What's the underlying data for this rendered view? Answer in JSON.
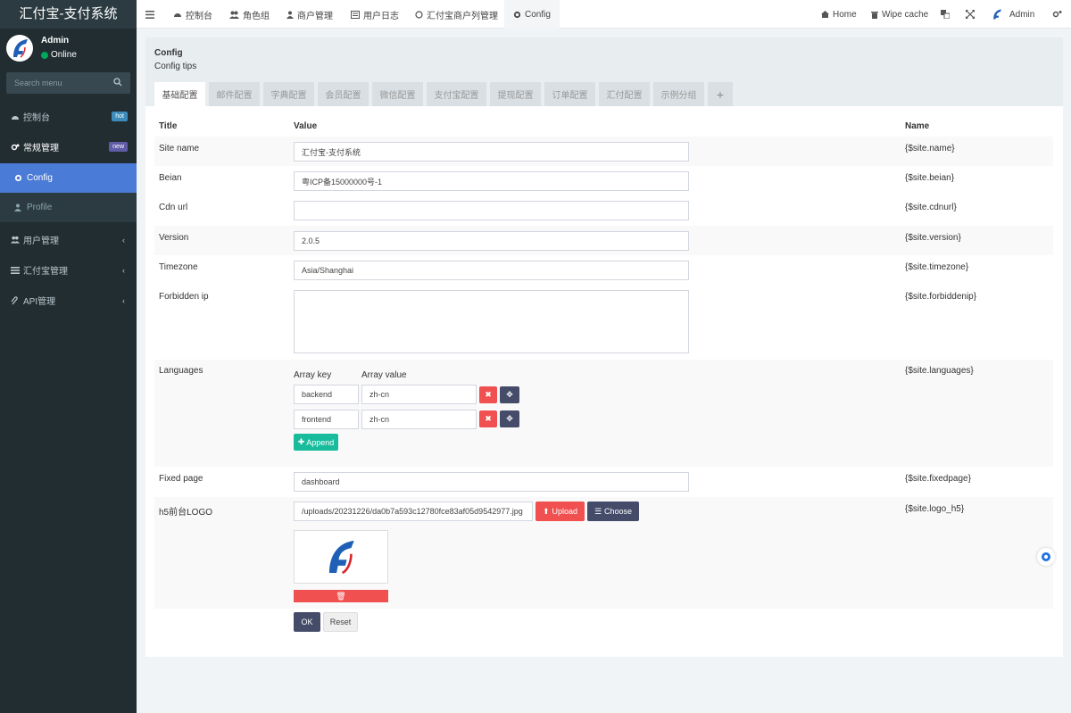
{
  "brand": "汇付宝-支付系统",
  "user": {
    "name": "Admin",
    "status": "Online"
  },
  "search": {
    "placeholder": "Search menu"
  },
  "sidebar": {
    "items": [
      {
        "label": "控制台",
        "badge": "hot"
      },
      {
        "label": "常规管理",
        "badge": "new"
      },
      {
        "label": "Config"
      },
      {
        "label": "Profile"
      },
      {
        "label": "用户管理"
      },
      {
        "label": "汇付宝管理"
      },
      {
        "label": "API管理"
      }
    ]
  },
  "topnav": {
    "tabs": [
      "控制台",
      "角色组",
      "商户管理",
      "用户日志",
      "汇付宝商户列管理",
      "Config"
    ],
    "right": {
      "home": "Home",
      "wipe": "Wipe cache",
      "admin": "Admin"
    }
  },
  "page": {
    "title": "Config",
    "tips": "Config tips",
    "tabs": [
      "基础配置",
      "邮件配置",
      "字典配置",
      "会员配置",
      "微信配置",
      "支付宝配置",
      "提现配置",
      "订单配置",
      "汇付配置",
      "示例分组"
    ],
    "columns": {
      "title": "Title",
      "value": "Value",
      "name": "Name"
    },
    "rows": [
      {
        "title": "Site name",
        "value": "汇付宝-支付系统",
        "name": "{$site.name}"
      },
      {
        "title": "Beian",
        "value": "粤ICP备15000000号-1",
        "name": "{$site.beian}"
      },
      {
        "title": "Cdn url",
        "value": "",
        "name": "{$site.cdnurl}"
      },
      {
        "title": "Version",
        "value": "2.0.5",
        "name": "{$site.version}"
      },
      {
        "title": "Timezone",
        "value": "Asia/Shanghai",
        "name": "{$site.timezone}"
      },
      {
        "title": "Forbidden ip",
        "value": "",
        "name": "{$site.forbiddenip}"
      },
      {
        "title": "Languages",
        "name": "{$site.languages}"
      },
      {
        "title": "Fixed page",
        "value": "dashboard",
        "name": "{$site.fixedpage}"
      },
      {
        "title": "h5前台LOGO",
        "value": "/uploads/20231226/da0b7a593c12780fce83af05d9542977.jpg",
        "name": "{$site.logo_h5}"
      }
    ],
    "languages": {
      "key_header": "Array key",
      "value_header": "Array value",
      "pairs": [
        {
          "key": "backend",
          "value": "zh-cn"
        },
        {
          "key": "frontend",
          "value": "zh-cn"
        }
      ],
      "append": "Append"
    },
    "upload": {
      "upload": "Upload",
      "choose": "Choose"
    },
    "actions": {
      "ok": "OK",
      "reset": "Reset"
    }
  },
  "colors": {
    "sidebar": "#222d32",
    "active": "#4a7bd6",
    "danger": "#f05050",
    "dark": "#444c69",
    "success": "#18bc9c"
  }
}
